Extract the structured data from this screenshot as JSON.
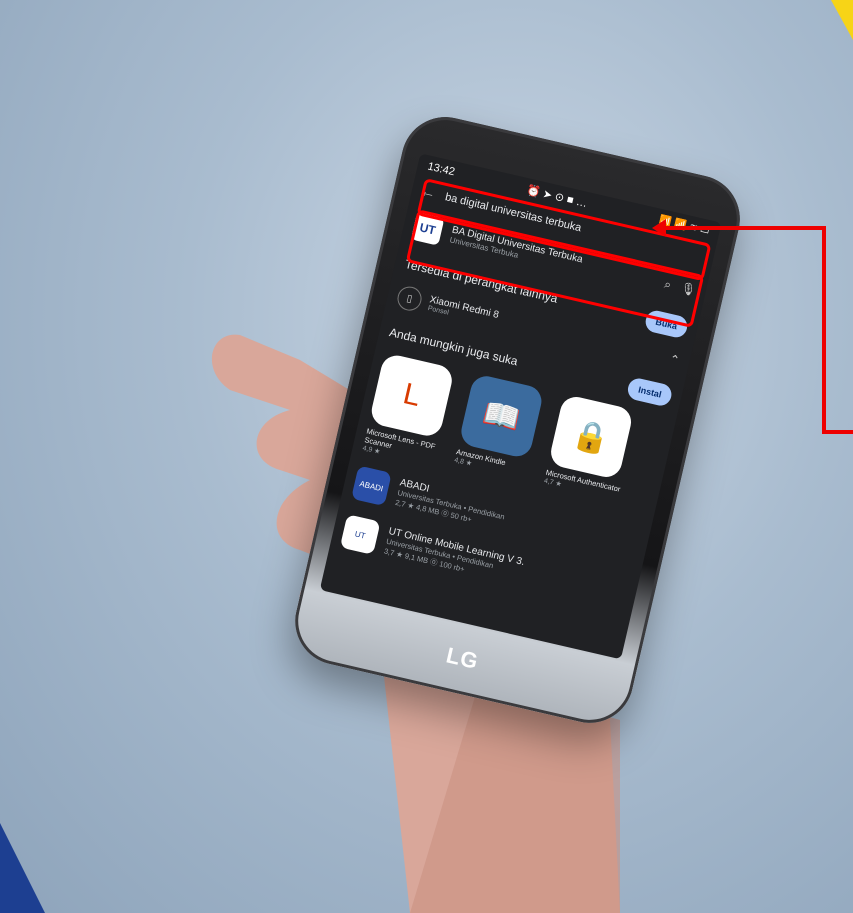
{
  "status": {
    "time": "13:42",
    "icons": "⏰ ➤ ⊙ ■ …",
    "right": "📶 📶 ≋ ▭"
  },
  "search": {
    "query": "ba digital universitas terbuka"
  },
  "result": {
    "logo": "UT",
    "title": "BA Digital Universitas Terbuka",
    "subtitle": "Universitas Terbuka"
  },
  "section1": {
    "label": "Tersedia di perangkat lainnya",
    "action": "Buka"
  },
  "device": {
    "name": "Xiaomi Redmi 8",
    "sub": "Ponsel",
    "action": "Instal"
  },
  "section2": {
    "label": "Anda mungkin juga suka"
  },
  "apps": [
    {
      "name": "Microsoft Lens - PDF Scanner",
      "rating": "4,9 ★",
      "glyph": "L",
      "color": "#d83b01"
    },
    {
      "name": "Amazon Kindle",
      "rating": "4,8 ★",
      "glyph": "📖",
      "color": "#1e2a3a"
    },
    {
      "name": "Microsoft Authenticator",
      "rating": "4,7 ★",
      "glyph": "🔒",
      "color": "#0a64c8"
    }
  ],
  "list": [
    {
      "name": "ABADI",
      "publisher": "Universitas Terbuka • Pendidikan",
      "meta": "2,7 ★  4,8 MB  ⓪ 50 rb+",
      "icon_text": "ABADI"
    },
    {
      "name": "UT Online Mobile Learning V 3.",
      "publisher": "Universitas Terbuka • Pendidikan",
      "meta": "3,7 ★  9,1 MB  ⓪ 100 rb+",
      "icon_text": "UT"
    }
  ],
  "phone_brand": "LG",
  "colors": {
    "highlight": "#ff0000",
    "screen_bg": "#202124",
    "pill": "#a8c7fa"
  }
}
